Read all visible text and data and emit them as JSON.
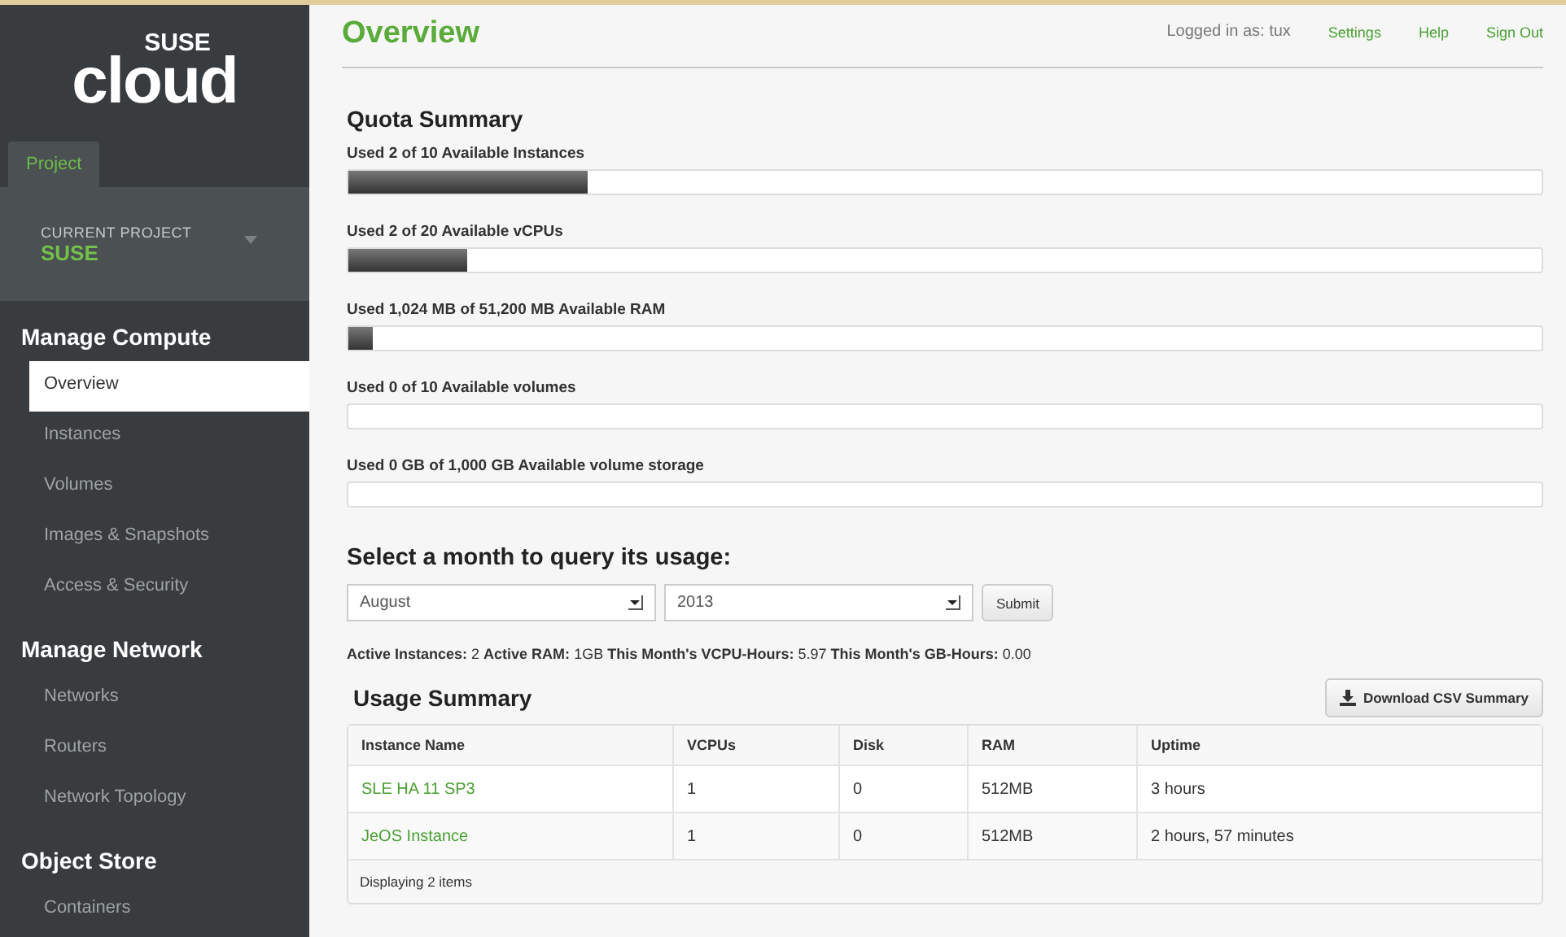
{
  "logo": {
    "top": "SUSE",
    "bottom": "cloud"
  },
  "sidebar": {
    "tabs": [
      {
        "label": "Project",
        "selected": true
      }
    ],
    "current_project": {
      "label": "CURRENT PROJECT",
      "value": "SUSE"
    },
    "sections": [
      {
        "title": "Manage Compute",
        "items": [
          {
            "label": "Overview",
            "selected": true
          },
          {
            "label": "Instances",
            "selected": false
          },
          {
            "label": "Volumes",
            "selected": false
          },
          {
            "label": "Images & Snapshots",
            "selected": false
          },
          {
            "label": "Access & Security",
            "selected": false
          }
        ]
      },
      {
        "title": "Manage Network",
        "items": [
          {
            "label": "Networks",
            "selected": false
          },
          {
            "label": "Routers",
            "selected": false
          },
          {
            "label": "Network Topology",
            "selected": false
          }
        ]
      },
      {
        "title": "Object Store",
        "items": [
          {
            "label": "Containers",
            "selected": false
          }
        ]
      }
    ]
  },
  "header": {
    "title": "Overview",
    "user": "Logged in as: tux",
    "links": [
      "Settings",
      "Help",
      "Sign Out"
    ]
  },
  "quota": {
    "title": "Quota Summary",
    "items": [
      {
        "label": "Used 2 of 10 Available Instances",
        "level": 0.2
      },
      {
        "label": "Used 2 of 20 Available vCPUs",
        "level": 0.1
      },
      {
        "label": "Used 1,024 MB of 51,200 MB Available RAM",
        "level": 0.02
      },
      {
        "label": "Used 0 of 10 Available volumes"
      },
      {
        "label": "Used 0 GB of 1,000 GB Available volume storage"
      }
    ]
  },
  "usage_query": {
    "title": "Select a month to query its usage:",
    "month": "August",
    "year": "2013",
    "submit": "Submit"
  },
  "stats": "**Active Instances:** 2 **Active RAM:** 1GB **This Month's VCPU-Hours:** 5.97 **This Month's GB-Hours:** 0.00",
  "usage_summary": {
    "title": "Usage Summary",
    "download": "Download CSV Summary",
    "table": {
      "columns": [
        "Instance Name",
        "VCPUs",
        "Disk",
        "RAM",
        "Uptime"
      ],
      "rows": [
        [
          "SLE HA 11 SP3",
          "1",
          "0",
          "512MB",
          "3 hours"
        ],
        [
          "JeOS Instance",
          "1",
          "0",
          "512MB",
          "2 hours, 57 minutes"
        ]
      ],
      "footer": "Displaying 2 items"
    }
  }
}
